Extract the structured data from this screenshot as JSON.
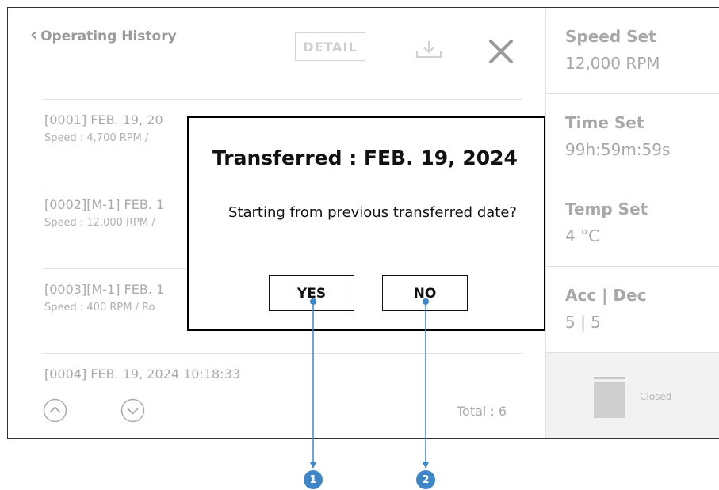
{
  "header": {
    "back_label": "Operating History",
    "detail_label": "DETAIL",
    "download_icon": "download-icon",
    "close_icon": "close-icon"
  },
  "history": {
    "rows": [
      {
        "line1": "[0001] FEB. 19, 20",
        "line2": "Speed : 4,700 RPM /"
      },
      {
        "line1": "[0002][M-1] FEB. 1",
        "line2": "Speed : 12,000 RPM /"
      },
      {
        "line1": "[0003][M-1] FEB. 1",
        "line2": "Speed : 400 RPM / Ro"
      },
      {
        "line1": "[0004] FEB. 19, 2024 10:18:33",
        "line2": ""
      }
    ],
    "total_label": "Total : 6"
  },
  "status": {
    "speed": {
      "label": "Speed Set",
      "value": "12,000 RPM"
    },
    "time": {
      "label": "Time Set",
      "value": "99h:59m:59s"
    },
    "temp": {
      "label": "Temp Set",
      "value": "4 °C"
    },
    "accdec": {
      "label": "Acc | Dec",
      "value": "5 | 5"
    },
    "door": {
      "label": "Closed"
    }
  },
  "dialog": {
    "title": "Transferred : FEB. 19, 2024",
    "message": "Starting from previous transferred date?",
    "yes_label": "YES",
    "no_label": "NO"
  },
  "callouts": {
    "one": "1",
    "two": "2",
    "color": "#3f86c8"
  },
  "colors": {
    "dim_text": "#aaaaaa",
    "border": "#333333",
    "accent": "#3f86c8"
  }
}
